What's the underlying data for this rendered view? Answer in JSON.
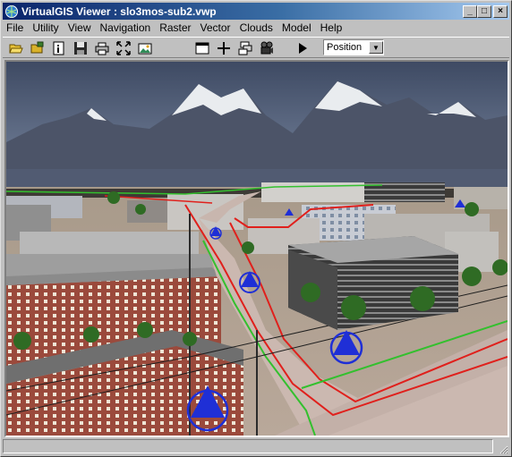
{
  "window": {
    "title": "VirtualGIS Viewer : slo3mos-sub2.vwp",
    "controls": {
      "minimize": "_",
      "maximize": "□",
      "close": "×"
    }
  },
  "menu": [
    {
      "id": "file",
      "label": "File"
    },
    {
      "id": "utility",
      "label": "Utility"
    },
    {
      "id": "view",
      "label": "View"
    },
    {
      "id": "navigation",
      "label": "Navigation"
    },
    {
      "id": "raster",
      "label": "Raster"
    },
    {
      "id": "vector",
      "label": "Vector"
    },
    {
      "id": "clouds",
      "label": "Clouds"
    },
    {
      "id": "model",
      "label": "Model"
    },
    {
      "id": "help",
      "label": "Help"
    }
  ],
  "toolbar": {
    "icons": [
      "open-folder-icon",
      "open-project-icon",
      "info-icon",
      "save-icon",
      "print-icon",
      "fit-to-window-icon",
      "snapshot-icon",
      "window-icon",
      "crosshair-icon",
      "layers-icon",
      "video-camera-icon",
      "play-icon"
    ],
    "mode_select": {
      "value": "Position"
    }
  },
  "scene": {
    "description_free": true,
    "sky_color": "#5a6b84",
    "marker_color": "#1f2fd6",
    "route_colors": [
      "#e0201c",
      "#33c02e"
    ]
  }
}
